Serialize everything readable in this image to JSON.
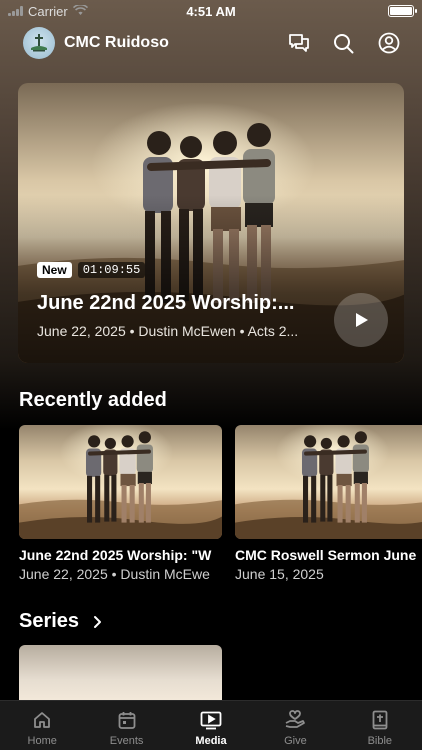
{
  "status_bar": {
    "carrier": "Carrier",
    "time": "4:51 AM"
  },
  "header": {
    "title": "CMC Ruidoso"
  },
  "hero": {
    "badge": "New",
    "duration": "01:09:55",
    "title": "June 22nd 2025 Worship:...",
    "meta": "June 22, 2025 • Dustin McEwen • Acts 2..."
  },
  "recently_added": {
    "title": "Recently added",
    "items": [
      {
        "title": "June 22nd 2025 Worship: \"W",
        "meta": "June 22, 2025 • Dustin McEwe"
      },
      {
        "title": "CMC Roswell Sermon June",
        "meta": "June 15, 2025"
      }
    ]
  },
  "series": {
    "title": "Series"
  },
  "tabs": [
    {
      "label": "Home",
      "icon": "home-icon",
      "active": false
    },
    {
      "label": "Events",
      "icon": "calendar-icon",
      "active": false
    },
    {
      "label": "Media",
      "icon": "media-icon",
      "active": true
    },
    {
      "label": "Give",
      "icon": "give-icon",
      "active": false
    },
    {
      "label": "Bible",
      "icon": "bible-icon",
      "active": false
    }
  ],
  "colors": {
    "background": "#000000",
    "tab_bar": "#1b1b1b",
    "inactive_tab": "#8e8e8e",
    "active_tab": "#ffffff"
  }
}
